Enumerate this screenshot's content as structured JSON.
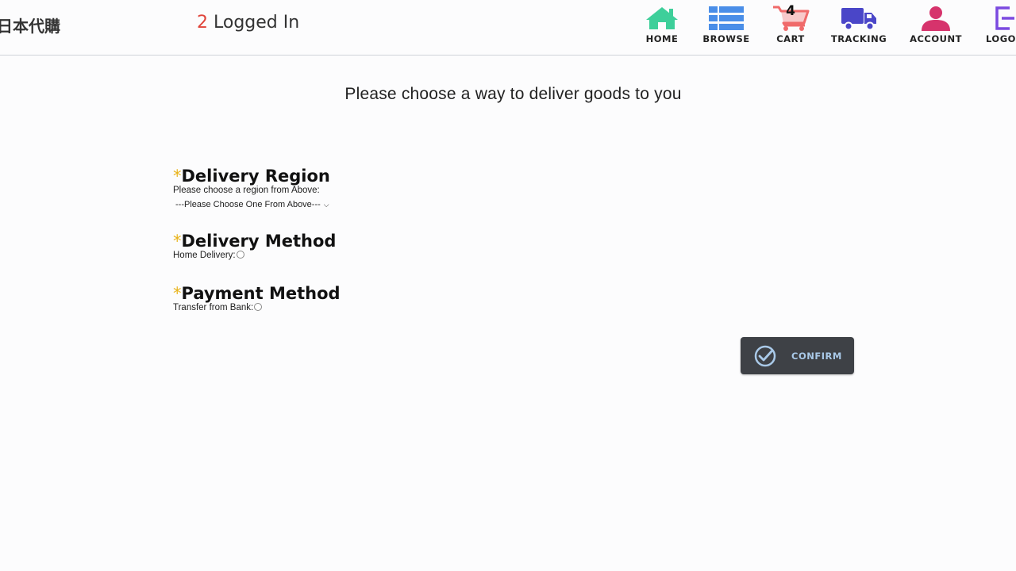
{
  "header": {
    "brand": "日本代購",
    "login_count": "2",
    "login_text": " Logged In",
    "nav": [
      {
        "label": "HOME",
        "icon": "home-icon",
        "color": "#3ecf9a"
      },
      {
        "label": "BROWSE",
        "icon": "list-icon",
        "color": "#4a8ee8"
      },
      {
        "label": "CART",
        "icon": "cart-icon",
        "color": "#f06a6a",
        "badge": "4"
      },
      {
        "label": "TRACKING",
        "icon": "truck-icon",
        "color": "#4a46c8"
      },
      {
        "label": "ACCOUNT",
        "icon": "user-icon",
        "color": "#d6336c"
      },
      {
        "label": "LOGOUT",
        "icon": "logout-icon",
        "color": "#7b4ae0"
      }
    ]
  },
  "main": {
    "title": "Please choose a way to deliver goods to you",
    "region": {
      "heading": "Delivery Region",
      "hint": "Please choose a region from Above:",
      "select_value": "---Please Choose One From Above---"
    },
    "method": {
      "heading": "Delivery Method",
      "option_label": "Home Delivery:"
    },
    "payment": {
      "heading": "Payment Method",
      "option_label": "Transfer from Bank:"
    },
    "required_mark": "*",
    "confirm_label": "CONFIRM"
  },
  "colors": {
    "required_star": "#e8b31a",
    "login_count": "#e0443a",
    "confirm_bg": "#3e4146",
    "confirm_text": "#a9c9e8"
  }
}
